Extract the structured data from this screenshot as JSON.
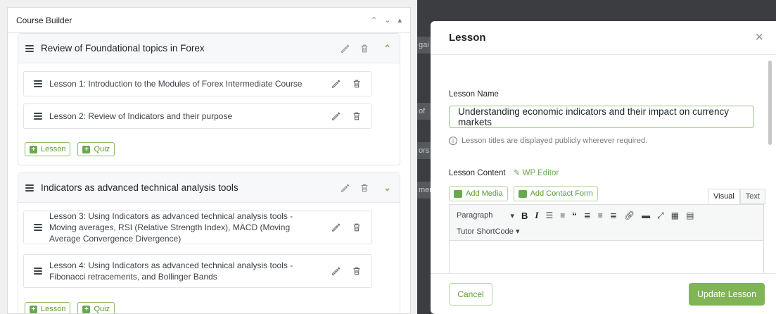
{
  "builder": {
    "title": "Course Builder",
    "controls": [
      "^",
      "v",
      "▴"
    ]
  },
  "topics": [
    {
      "title": "Review of Foundational topics in Forex",
      "lessons": [
        "Lesson 1: Introduction to the Modules of Forex Intermediate Course",
        "Lesson 2: Review of Indicators and their purpose"
      ]
    },
    {
      "title": "Indicators as advanced technical analysis tools",
      "lessons": [
        "Lesson 3: Using Indicators as advanced technical analysis tools - Moving averages, RSI (Relative Strength Index), MACD (Moving Average Convergence Divergence)",
        "Lesson 4: Using Indicators as advanced technical analysis tools - Fibonacci retracements, and Bollinger Bands"
      ]
    }
  ],
  "add_buttons": {
    "lesson": "Lesson",
    "quiz": "Quiz"
  },
  "background_fragments": [
    "gai (",
    "of",
    "ors",
    "men"
  ],
  "modal": {
    "title": "Lesson",
    "close": "×",
    "lesson_name_label": "Lesson Name",
    "lesson_name_value": "Understanding economic indicators and their impact on currency markets",
    "hint": "Lesson titles are displayed publicly wherever required.",
    "content_label": "Lesson Content",
    "wp_editor": "WP Editor",
    "add_media": "Add Media",
    "add_contact_form": "Add Contact Form",
    "tab_visual": "Visual",
    "tab_text": "Text",
    "paragraph": "Paragraph",
    "shortcode": "Tutor ShortCode ▾",
    "cancel": "Cancel",
    "update": "Update Lesson"
  },
  "colors": {
    "accent": "#80b455",
    "accent_text": "#5a9d2f",
    "backdrop": "#3b3d40"
  },
  "icons": [
    "drag-handle-icon",
    "edit-icon",
    "trash-icon",
    "chevron-up-icon",
    "chevron-down-icon",
    "plus-icon",
    "info-icon",
    "close-icon"
  ]
}
